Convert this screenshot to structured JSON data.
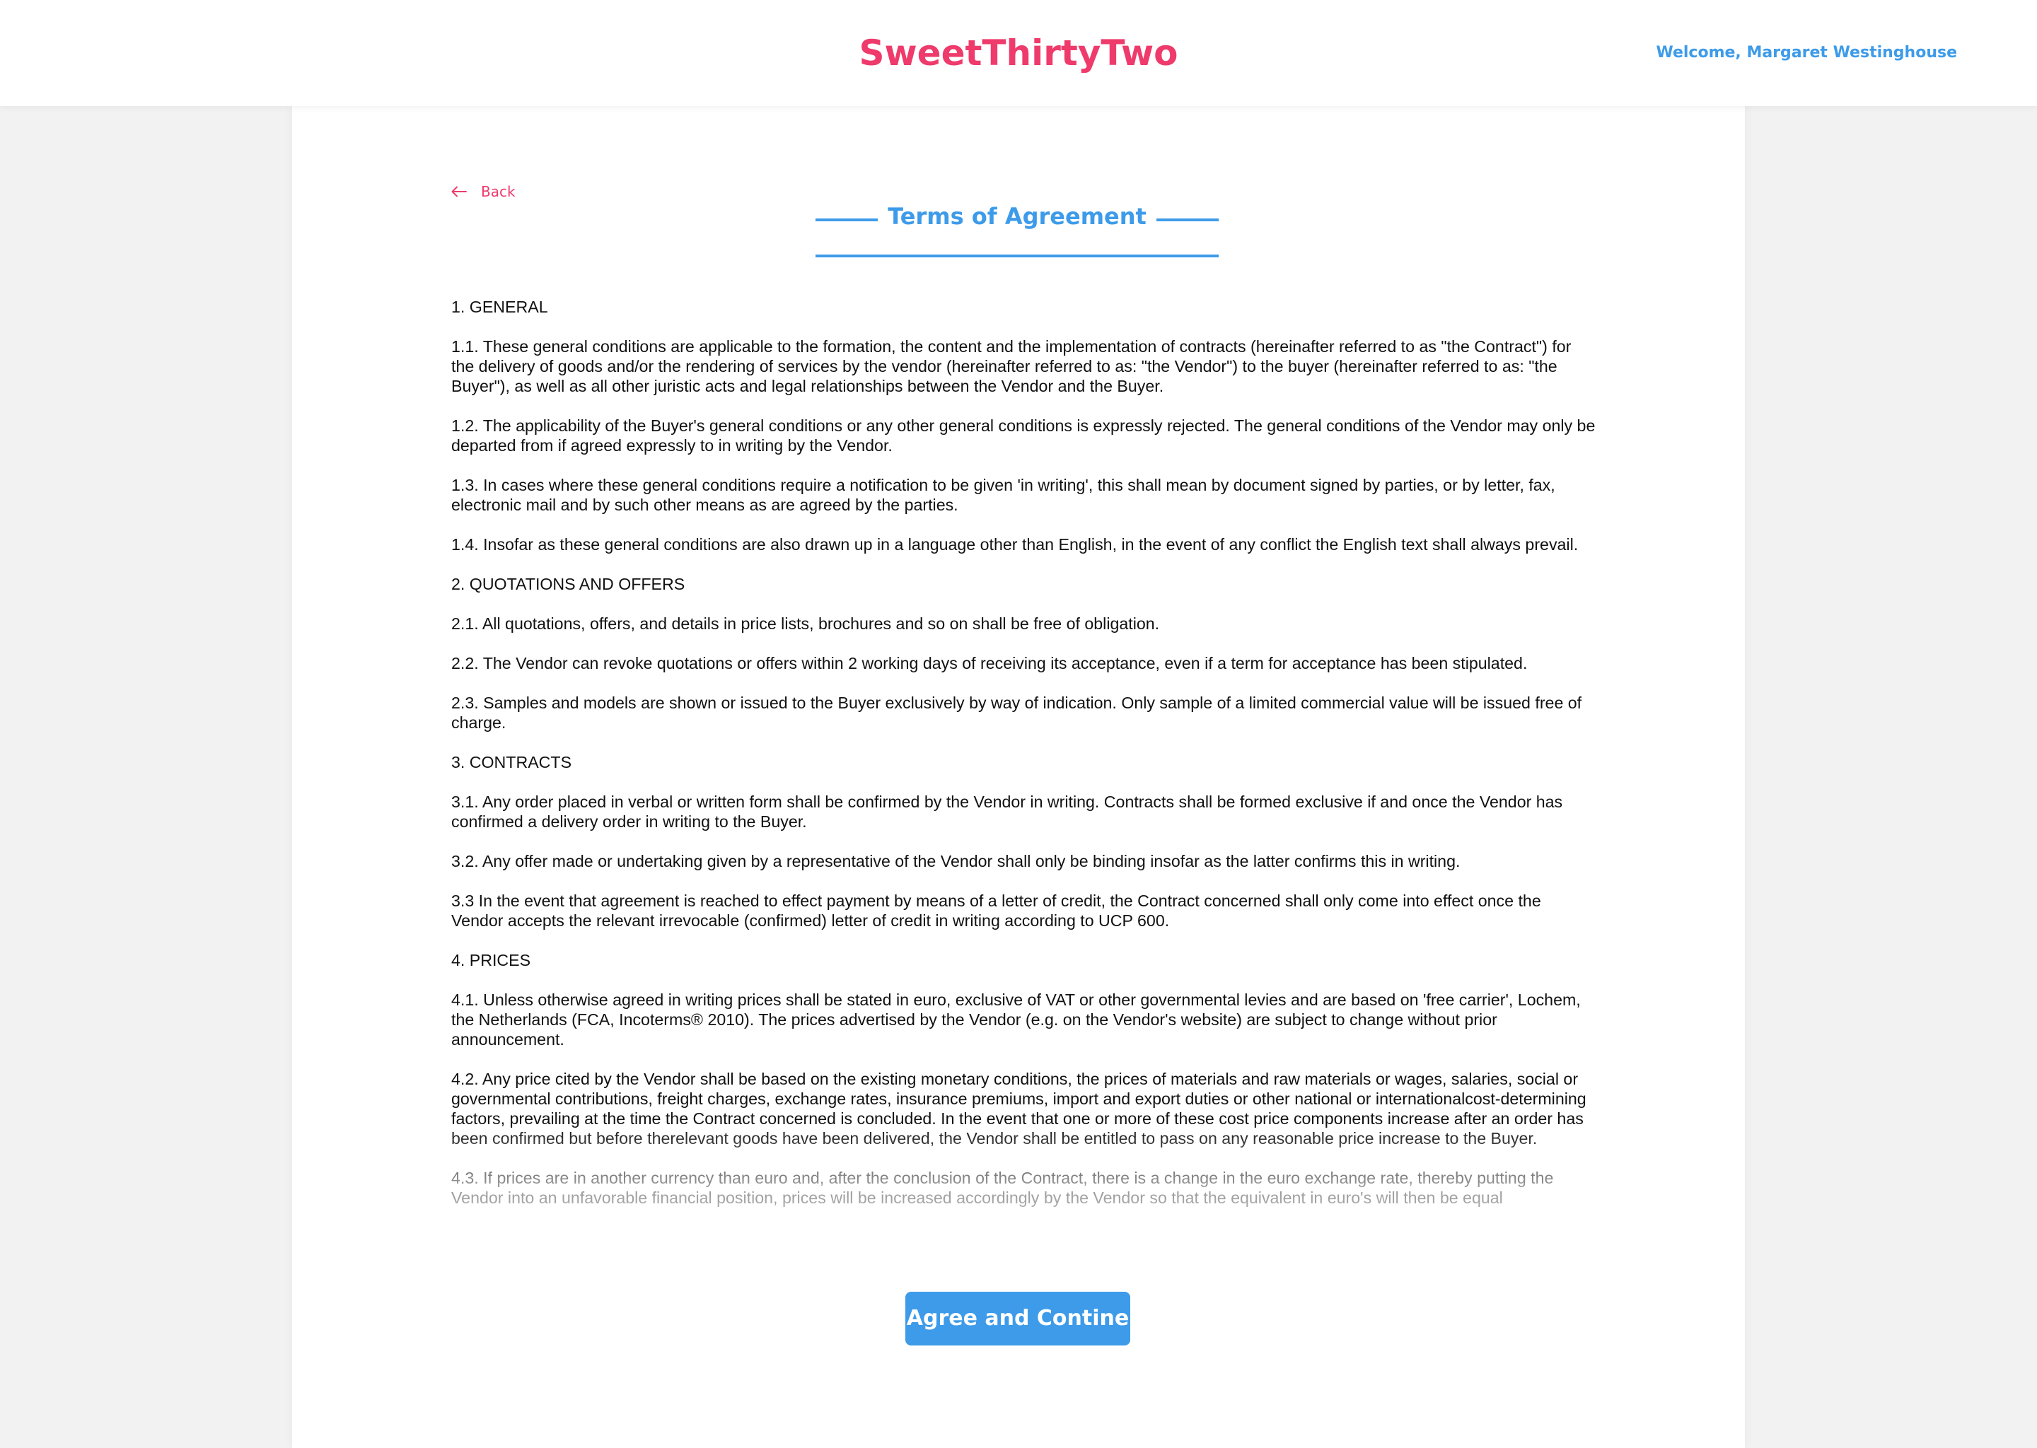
{
  "header": {
    "brand": "SweetThirtyTwo",
    "welcome": "Welcome, Margaret Westinghouse"
  },
  "nav": {
    "back_label": "Back"
  },
  "page": {
    "title": "Terms of Agreement"
  },
  "terms": {
    "paragraphs": [
      "1. GENERAL",
      "1.1. These general conditions are applicable to the formation, the content and the implementation of contracts (hereinafter referred to as \"the Contract\") for the delivery of goods and/or the rendering of services by the vendor (hereinafter referred to as: \"the Vendor\") to the buyer (hereinafter referred to as: \"the Buyer\"), as well as all other juristic acts and legal relationships between the Vendor and the Buyer.",
      "1.2. The applicability of the Buyer's general conditions or any other general conditions is expressly rejected. The general conditions of the Vendor may only be departed from if agreed expressly to in writing by the Vendor.",
      "1.3. In cases where these general conditions require a notification to be given 'in writing', this shall mean by document signed by parties, or by letter, fax, electronic mail and by such other means as are agreed by the parties.",
      "1.4. Insofar as these general conditions are also drawn up in a language other than English, in the event of any conflict the English text shall always prevail.",
      "2. QUOTATIONS AND OFFERS",
      "2.1. All quotations, offers, and details in price lists, brochures and so on shall be free of obligation.",
      "2.2. The Vendor can revoke quotations or offers within 2 working days of receiving its acceptance, even if a term for acceptance has been stipulated.",
      "2.3. Samples and models are shown or issued to the Buyer exclusively by way of indication. Only sample of a limited commercial value will be issued free of charge.",
      "3. CONTRACTS",
      "3.1. Any order placed in verbal or written form shall be confirmed by the Vendor in writing. Contracts shall be formed exclusive if and once the Vendor has confirmed a delivery order in writing to the Buyer.",
      "3.2. Any offer made or undertaking given by a representative of the Vendor shall only be binding insofar as the latter confirms this in writing.",
      "3.3 In the event that agreement is reached to effect payment by means of a letter of credit, the Contract concerned shall only come into effect once the Vendor accepts the relevant irrevocable (confirmed) letter of credit in writing according to UCP 600.",
      "4. PRICES",
      "4.1. Unless otherwise agreed in writing prices shall be stated in euro, exclusive of VAT or other governmental levies and are based on 'free carrier', Lochem, the Netherlands (FCA, Incoterms® 2010). The prices advertised by the Vendor (e.g. on the Vendor's website) are subject to change without prior announcement.",
      "4.2. Any price cited by the Vendor shall be based on the existing monetary conditions, the prices of materials and raw materials or wages, salaries, social or governmental contributions, freight charges, exchange rates, insurance premiums, import and export duties or other national or internationalcost-determining factors, prevailing at the time the Contract concerned is concluded. In the event that one or more of these cost price components increase after an order has been confirmed but before therelevant goods have been delivered, the Vendor shall be entitled to pass on any reasonable price increase to the Buyer.",
      "4.3. If prices are in another currency than euro and, after the conclusion of the Contract, there is a change in the euro exchange rate, thereby putting the Vendor into an unfavorable financial position, prices will be increased accordingly by the Vendor so that the equivalent in euro's will then be equal"
    ]
  },
  "actions": {
    "agree_label": "Agree and Contine"
  },
  "colors": {
    "brand": "#ee3b6c",
    "accent": "#3d9be9",
    "page_background": "#f2f2f2"
  },
  "icons": {
    "back": "arrow-left-icon"
  }
}
